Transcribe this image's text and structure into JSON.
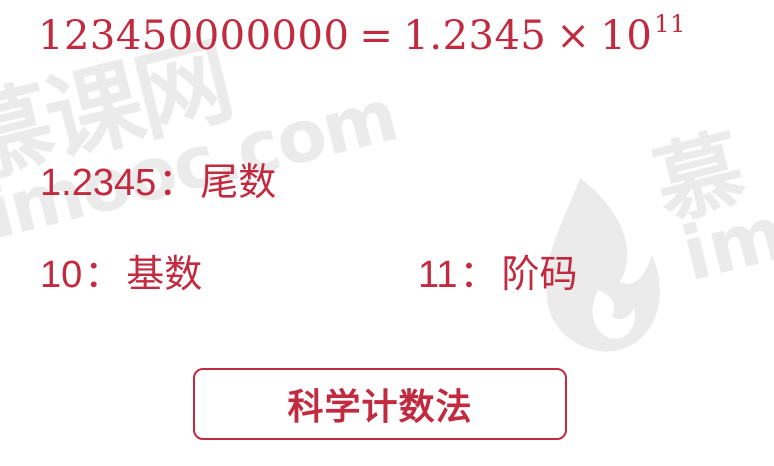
{
  "colors": {
    "accent": "#c22a3f",
    "background": "#ffffff",
    "watermark": "#ebebeb"
  },
  "equation": {
    "number": "123450000000",
    "equals": "=",
    "mantissa": "1.2345",
    "times": "×",
    "base": "10",
    "exponent": "11"
  },
  "terms": {
    "mantissa": {
      "value": "1.2345",
      "separator": "：",
      "label": "尾数"
    },
    "base": {
      "value": "10",
      "separator": "：",
      "label": "基数"
    },
    "exponent": {
      "value": "11",
      "separator": "：",
      "label": "阶码"
    }
  },
  "button": {
    "label": "科学计数法"
  },
  "watermark": {
    "left_text": "慕课网",
    "left_url": "imooc.com",
    "right_text": "慕",
    "right_url": "im",
    "icon": "flame-logo"
  }
}
